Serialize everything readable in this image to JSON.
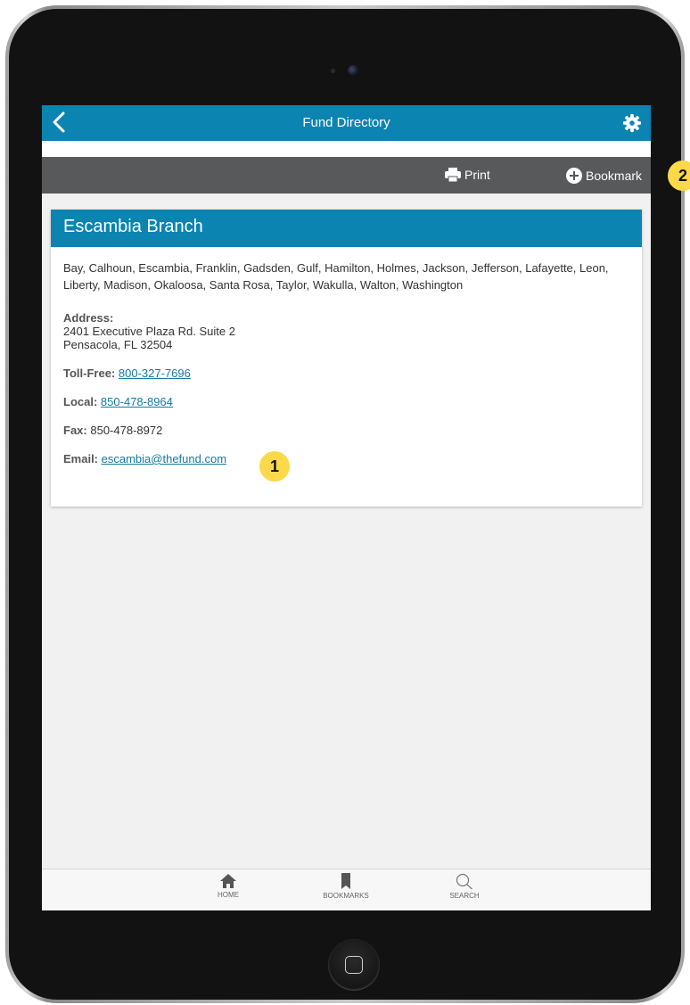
{
  "header": {
    "title": "Fund Directory",
    "back_icon": "chevron-left-icon",
    "settings_icon": "gear-icon"
  },
  "actions": {
    "print_label": "Print",
    "bookmark_label": "Bookmark"
  },
  "branch": {
    "name": "Escambia Branch",
    "counties": "Bay, Calhoun, Escambia, Franklin, Gadsden, Gulf, Hamilton, Holmes, Jackson, Jefferson, Lafayette, Leon, Liberty, Madison, Okaloosa, Santa Rosa, Taylor, Wakulla, Walton, Washington",
    "address_label": "Address:",
    "address_line1": "2401 Executive Plaza Rd. Suite 2",
    "address_line2": "Pensacola, FL 32504",
    "tollfree_label": "Toll-Free:",
    "tollfree": "800-327-7696",
    "local_label": "Local:",
    "local": "850-478-8964",
    "fax_label": "Fax:",
    "fax": "850-478-8972",
    "email_label": "Email:",
    "email": "escambia@thefund.com"
  },
  "tabs": [
    {
      "label": "HOME",
      "icon": "home-icon"
    },
    {
      "label": "BOOKMARKS",
      "icon": "bookmark-icon"
    },
    {
      "label": "SEARCH",
      "icon": "search-icon"
    }
  ],
  "callouts": {
    "one": "1",
    "two": "2"
  },
  "colors": {
    "brand_blue": "#0b84b2",
    "action_bar": "#58595b",
    "callout": "#fbd94b",
    "link": "#1779a3"
  }
}
